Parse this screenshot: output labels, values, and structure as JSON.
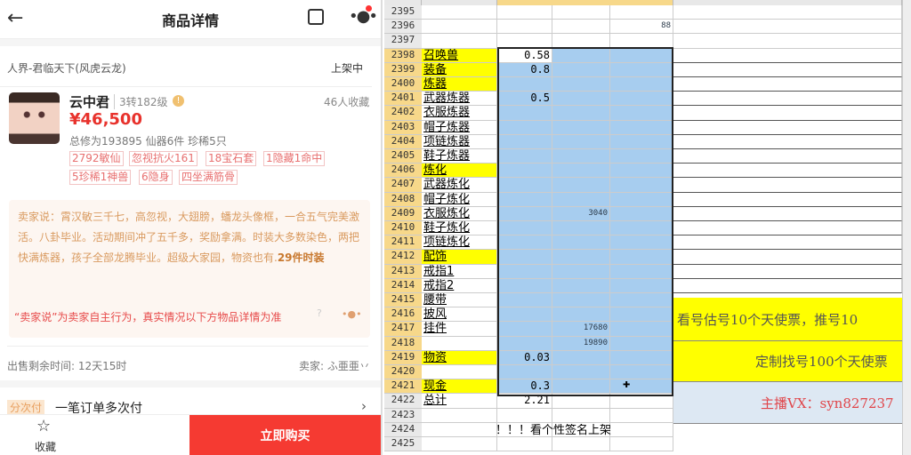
{
  "app": {
    "title": "商品详情",
    "server": "人界-君临天下(风虎云龙)",
    "status": "上架中",
    "name": "云中君",
    "level": "3转182级",
    "favorites": "46人收藏",
    "price": "¥46,500",
    "stats": "总修为193895  仙器6件  珍稀5只",
    "tags": [
      "2792敏仙",
      "忽视抗火161",
      "18宝石套",
      "1隐藏1命中",
      "5珍稀1神兽",
      "6隐身",
      "四坐满筋骨"
    ],
    "seller_says": "卖家说：霄汉敏三千七，高忽视，大翅膀，蟠龙头像框，一合五气完美激活。八卦毕业。活动期间冲了五千多，奖励拿满。时装大多数染色，两把快满炼器，孩子全部龙腾毕业。超级大家园，物资也有.",
    "seller_says_bold": "29件时装",
    "disclaimer": "“卖家说”为卖家自主行为，真实情况以下方物品详情为准",
    "time_left": "出售剩余时间: 12天15时",
    "seller": "卖家: ふ亜亜丷",
    "installment_badge": "分次付",
    "installment_text": "一笔订单多次付",
    "favorite_label": "收藏",
    "buy_label": "立即购买"
  },
  "sheet": {
    "rows": [
      {
        "n": "2395",
        "a": "",
        "b": "",
        "c": "",
        "d": ""
      },
      {
        "n": "2396",
        "a": "",
        "b": "",
        "c": "",
        "d": "88"
      },
      {
        "n": "2397",
        "a": "",
        "b": "",
        "c": "",
        "d": ""
      },
      {
        "n": "2398",
        "a": "召唤兽",
        "y": true,
        "b": "0.58",
        "c": "",
        "d": ""
      },
      {
        "n": "2399",
        "a": "装备",
        "y": true,
        "b": "0.8",
        "c": "",
        "d": ""
      },
      {
        "n": "2400",
        "a": "炼器",
        "y": true,
        "b": "",
        "c": "",
        "d": ""
      },
      {
        "n": "2401",
        "a": "武器炼器",
        "b": "0.5",
        "c": "",
        "d": ""
      },
      {
        "n": "2402",
        "a": "衣服炼器",
        "b": "",
        "c": "",
        "d": ""
      },
      {
        "n": "2403",
        "a": "帽子炼器",
        "b": "",
        "c": "",
        "d": ""
      },
      {
        "n": "2404",
        "a": "项链炼器",
        "b": "",
        "c": "",
        "d": ""
      },
      {
        "n": "2405",
        "a": "鞋子炼器",
        "b": "",
        "c": "",
        "d": ""
      },
      {
        "n": "2406",
        "a": "炼化",
        "y": true,
        "b": "",
        "c": "",
        "d": ""
      },
      {
        "n": "2407",
        "a": "武器炼化",
        "b": "",
        "c": "",
        "d": ""
      },
      {
        "n": "2408",
        "a": "帽子炼化",
        "b": "",
        "c": "",
        "d": ""
      },
      {
        "n": "2409",
        "a": "衣服炼化",
        "b": "",
        "c": "3040",
        "d": ""
      },
      {
        "n": "2410",
        "a": "鞋子炼化",
        "b": "",
        "c": "",
        "d": ""
      },
      {
        "n": "2411",
        "a": "项链炼化",
        "b": "",
        "c": "",
        "d": ""
      },
      {
        "n": "2412",
        "a": "配饰",
        "y": true,
        "b": "",
        "c": "",
        "d": ""
      },
      {
        "n": "2413",
        "a": "戒指1",
        "b": "",
        "c": "",
        "d": ""
      },
      {
        "n": "2414",
        "a": "戒指2",
        "b": "",
        "c": "",
        "d": ""
      },
      {
        "n": "2415",
        "a": "腰带",
        "b": "",
        "c": "",
        "d": ""
      },
      {
        "n": "2416",
        "a": "披风",
        "b": "",
        "c": "",
        "d": ""
      },
      {
        "n": "2417",
        "a": "挂件",
        "b": "",
        "c": "17680",
        "d": ""
      },
      {
        "n": "2418",
        "a": "",
        "b": "",
        "c": "19890",
        "d": ""
      },
      {
        "n": "2419",
        "a": "物资",
        "y": true,
        "b": "0.03",
        "c": "",
        "d": ""
      },
      {
        "n": "2420",
        "a": "",
        "b": "",
        "c": "",
        "d": ""
      },
      {
        "n": "2421",
        "a": "现金",
        "y": true,
        "b": "0.3",
        "c": "",
        "d": ""
      },
      {
        "n": "2422",
        "a": "总计",
        "b": "2.21",
        "c": "",
        "d": ""
      },
      {
        "n": "2423",
        "a": "",
        "b": "",
        "c": "",
        "d": ""
      },
      {
        "n": "2424",
        "a": "",
        "b": "",
        "c": "",
        "d": ""
      },
      {
        "n": "2425",
        "a": "",
        "b": "",
        "c": "",
        "d": ""
      }
    ],
    "overflow_text": "看个性签名上架！！！",
    "banner1": "看号估号10个天使票，推号10",
    "banner2": "定制找号100个天使票",
    "banner3": "主播VX：syn827237",
    "colors": {
      "yellow": "#ffff00",
      "selection": "#a7cdef",
      "banner_blue": "#dde8f3",
      "banner_red": "#e0454a"
    }
  }
}
